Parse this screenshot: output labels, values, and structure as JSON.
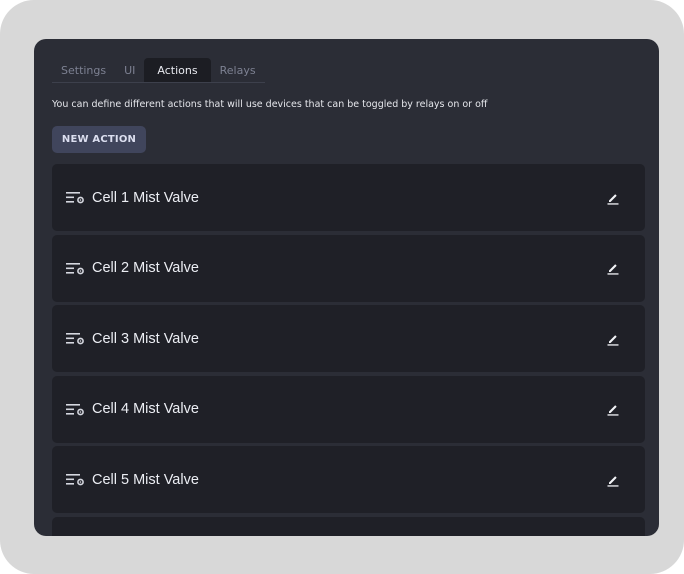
{
  "tabs": [
    {
      "label": "Settings"
    },
    {
      "label": "UI"
    },
    {
      "label": "Actions"
    },
    {
      "label": "Relays"
    }
  ],
  "active_tab": "Actions",
  "description": "You can define different actions that will use devices that can be toggled by relays on or off",
  "new_action_button": "NEW ACTION",
  "actions": [
    {
      "label": "Cell 1 Mist Valve",
      "icon": "list-settings-icon"
    },
    {
      "label": "Cell 2 Mist Valve",
      "icon": "list-settings-icon"
    },
    {
      "label": "Cell 3 Mist Valve",
      "icon": "list-settings-icon"
    },
    {
      "label": "Cell 4 Mist Valve",
      "icon": "list-settings-icon"
    },
    {
      "label": "Cell 5 Mist Valve",
      "icon": "list-settings-icon"
    }
  ],
  "edit_icon": "pencil-icon",
  "colors": {
    "panel_bg": "#2b2d36",
    "item_bg": "#1f2027",
    "button_bg": "#40455c",
    "frame_bg": "#d8d8d8"
  }
}
